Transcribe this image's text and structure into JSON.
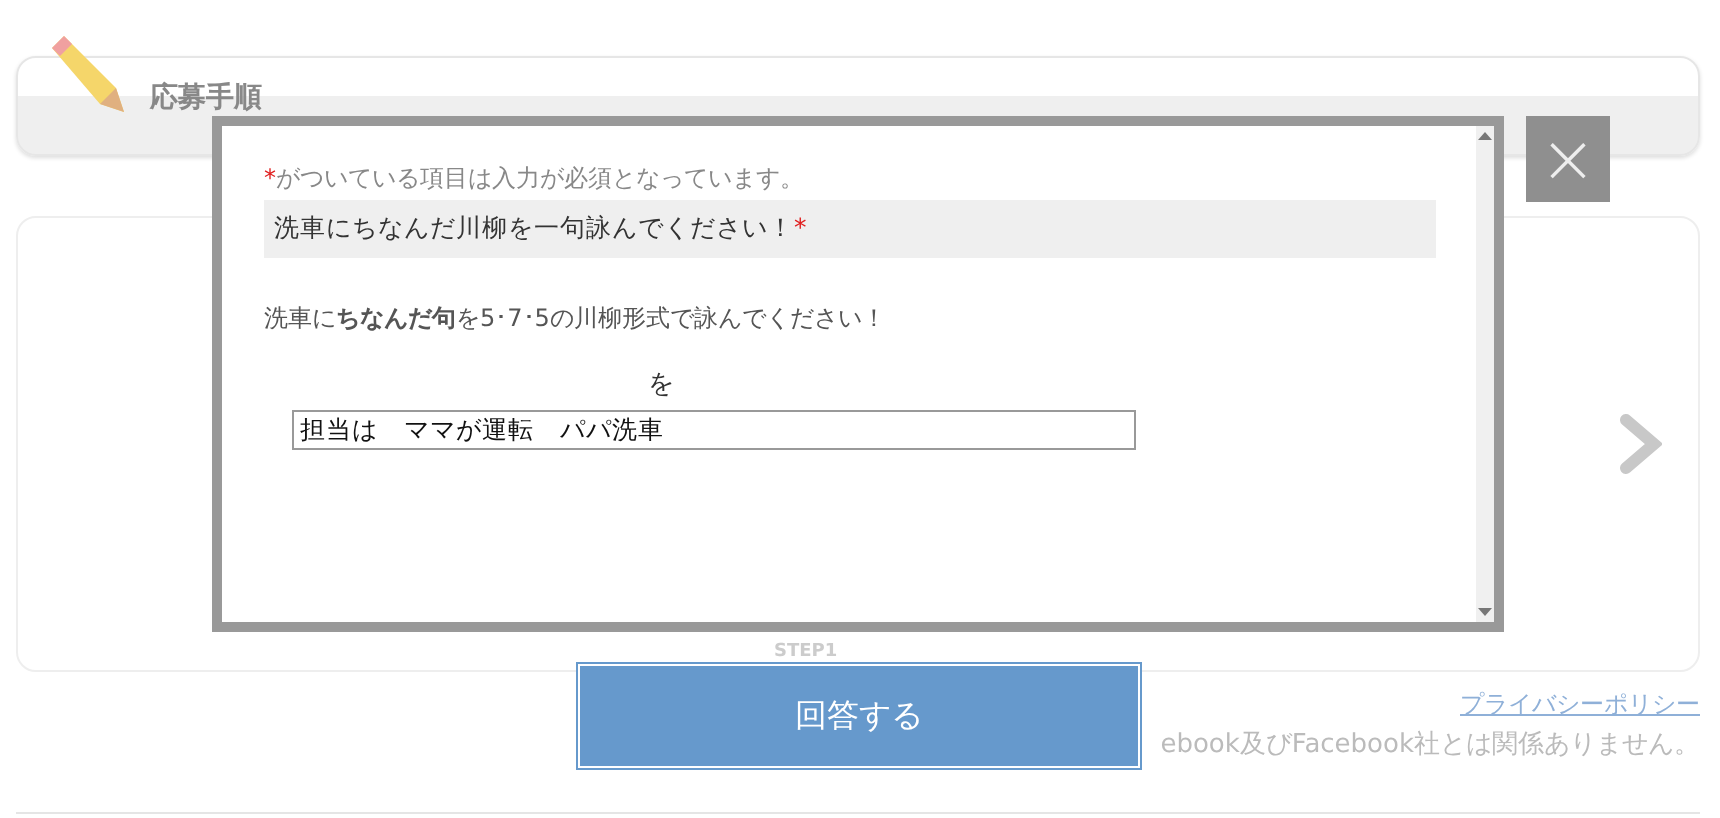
{
  "page": {
    "heading": "応募手順",
    "step_label": "STEP1",
    "privacy_link": "プライバシーポリシー",
    "footer_note": "ebook及びFacebook社とは関係ありません。"
  },
  "modal": {
    "required_note": {
      "mark": "*",
      "text": "がついている項目は入力が必須となっています。"
    },
    "question": {
      "text": "洗車にちなんだ川柳を一句詠んでください！",
      "mark": "*"
    },
    "description": "洗車に**ちなんだ句**を5･7･5の川柳形式で詠んでください！",
    "field_caption": "を",
    "answer": {
      "value": "担当は　ママが運転　パパ洗車"
    },
    "close": "×"
  },
  "submit_button": "回答する"
}
